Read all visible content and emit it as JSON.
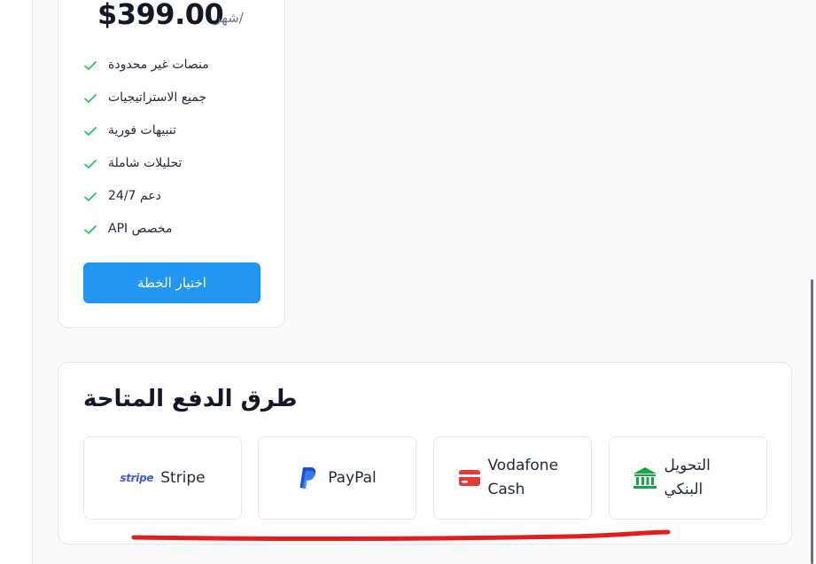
{
  "plan": {
    "price": "$399.00",
    "period": "شهر/",
    "features": [
      "منصات غير محدودة",
      "جميع الاستراتيجيات",
      "تنبيهات فورية",
      "تحليلات شاملة",
      "دعم 24/7",
      "API مخصص"
    ],
    "choose_label": "اختيار الخطة"
  },
  "payment": {
    "title": "طرق الدفع المتاحة",
    "methods": [
      {
        "logo": "stripe",
        "label": "Stripe"
      },
      {
        "label": "PayPal"
      },
      {
        "label_line1": "Vodafone",
        "label_line2": "Cash"
      },
      {
        "label_line1": "التحويل",
        "label_line2": "البنكي"
      }
    ]
  },
  "colors": {
    "accent": "#2196f3",
    "check": "#22c55e",
    "vodafone": "#e53935",
    "bank": "#16a34a",
    "paypal": "#1d4ed8",
    "annotation": "#e11d1d"
  }
}
